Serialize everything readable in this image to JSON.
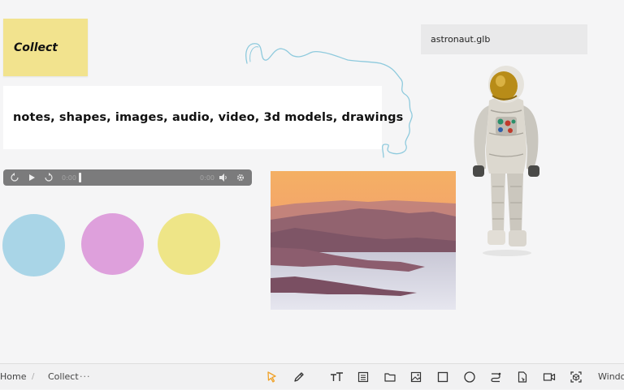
{
  "notes": {
    "collect_title": "Collect",
    "content_types": "notes, shapes, images, audio, video, 3d models, drawings"
  },
  "model": {
    "filename": "astronaut.glb"
  },
  "audio_player": {
    "current_time": "0:00",
    "duration": "0:00",
    "progress_fraction": 0.0
  },
  "shapes": [
    {
      "color": "#a9d5e7"
    },
    {
      "color": "#dea0dc"
    },
    {
      "color": "#eee587"
    }
  ],
  "breadcrumb": {
    "home": "Home",
    "separator": "/",
    "current": "Collect",
    "more": "···"
  },
  "toolbar": {
    "tools": [
      "select-icon",
      "pen-icon",
      "text-icon",
      "note-icon",
      "folder-icon",
      "image-icon",
      "rectangle-icon",
      "circle-icon",
      "connector-icon",
      "file-icon",
      "video-icon",
      "3d-model-icon"
    ],
    "active_tool": "select-icon",
    "active_color": "#f0a22a",
    "window_label": "Window"
  }
}
